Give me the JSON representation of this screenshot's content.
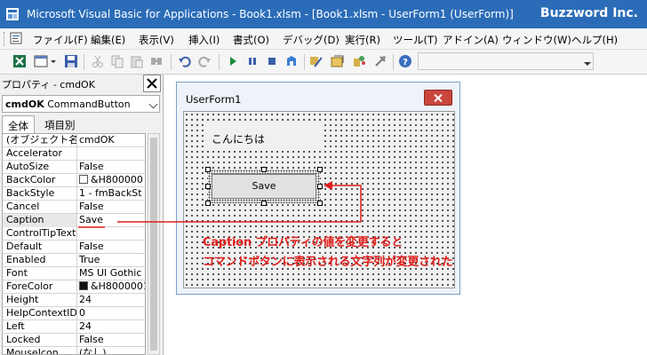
{
  "window": {
    "title": "Microsoft Visual Basic for Applications - Book1.xlsm - [Book1.xlsm - UserForm1 (UserForm)]",
    "brand": "Buzzword Inc."
  },
  "menubar": {
    "items": [
      "ファイル(F)",
      "編集(E)",
      "表示(V)",
      "挿入(I)",
      "書式(O)",
      "デバッグ(D)",
      "実行(R)",
      "ツール(T)",
      "アドイン(A)",
      "ウィンドウ(W)",
      "ヘルプ(H)"
    ]
  },
  "properties": {
    "title": "プロパティ - cmdOK",
    "object_name": "cmdOK",
    "object_type": "CommandButton",
    "tabs": [
      "全体",
      "項目別"
    ],
    "active_tab": "全体",
    "rows": [
      {
        "name": "(オブジェクト名)",
        "value": "cmdOK"
      },
      {
        "name": "Accelerator",
        "value": ""
      },
      {
        "name": "AutoSize",
        "value": "False"
      },
      {
        "name": "BackColor",
        "value": "&H800000",
        "swatch": "white"
      },
      {
        "name": "BackStyle",
        "value": "1 - fmBackSt"
      },
      {
        "name": "Cancel",
        "value": "False"
      },
      {
        "name": "Caption",
        "value": "Save",
        "selected": true
      },
      {
        "name": "ControlTipText",
        "value": ""
      },
      {
        "name": "Default",
        "value": "False"
      },
      {
        "name": "Enabled",
        "value": "True"
      },
      {
        "name": "Font",
        "value": "MS UI Gothic"
      },
      {
        "name": "ForeColor",
        "value": "&H8000001",
        "swatch": "black"
      },
      {
        "name": "Height",
        "value": "24"
      },
      {
        "name": "HelpContextID",
        "value": "0"
      },
      {
        "name": "Left",
        "value": "24"
      },
      {
        "name": "Locked",
        "value": "False"
      },
      {
        "name": "MouseIcon",
        "value": "(なし)"
      }
    ]
  },
  "userform": {
    "title": "UserForm1",
    "label_caption": "こんにちは",
    "button_caption": "Save"
  },
  "annotation": {
    "line1": "Caption プロパティの値を変更すると",
    "line2": "コマンドボタンに表示される文字列が変更された",
    "color": "#e0201c"
  }
}
